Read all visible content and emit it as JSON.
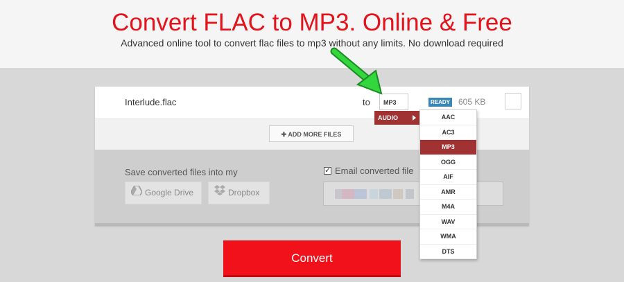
{
  "header": {
    "title": "Convert FLAC to MP3. Online & Free",
    "subtitle": "Advanced online tool to convert flac files to mp3 without any limits. No download required"
  },
  "file": {
    "name": "Interlude.flac",
    "to_label": "to",
    "format_value": "MP3",
    "status_badge": "READY",
    "size": "605 KB"
  },
  "add_more_label": "ADD MORE FILES",
  "save": {
    "label": "Save converted files into my",
    "google_drive": "Google Drive",
    "dropbox": "Dropbox"
  },
  "email": {
    "checkbox_checked": true,
    "label": "Email converted file"
  },
  "dropdown": {
    "category": "AUDIO",
    "options": [
      "AAC",
      "AC3",
      "MP3",
      "OGG",
      "AIF",
      "AMR",
      "M4A",
      "WAV",
      "WMA",
      "DTS"
    ],
    "selected": "MP3"
  },
  "convert_label": "Convert",
  "colors": {
    "title": "#e4131b",
    "convert": "#f0111a",
    "dropdown_selected": "#a03234",
    "ready_badge": "#3a86b6",
    "annotation_arrow": "#22c22e"
  }
}
